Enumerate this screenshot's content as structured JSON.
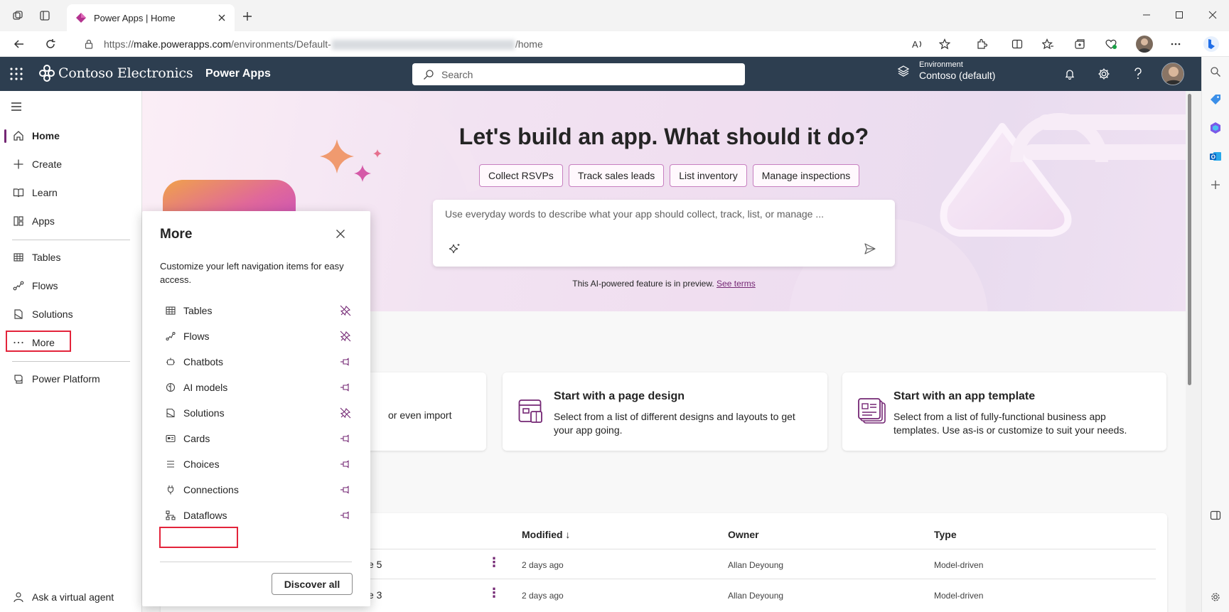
{
  "browser": {
    "tab_title": "Power Apps | Home",
    "url_prefix": "https://",
    "url_host": "make.powerapps.com",
    "url_path": "/environments/Default-",
    "url_tail": "/home"
  },
  "header": {
    "brand": "Contoso Electronics",
    "product": "Power Apps",
    "search_placeholder": "Search",
    "environment_label": "Environment",
    "environment_value": "Contoso (default)"
  },
  "nav": {
    "items": [
      {
        "label": "Home",
        "icon": "home-icon"
      },
      {
        "label": "Create",
        "icon": "plus-icon"
      },
      {
        "label": "Learn",
        "icon": "book-icon"
      },
      {
        "label": "Apps",
        "icon": "apps-icon"
      },
      {
        "label": "Tables",
        "icon": "table-icon"
      },
      {
        "label": "Flows",
        "icon": "flow-icon"
      },
      {
        "label": "Solutions",
        "icon": "solutions-icon"
      },
      {
        "label": "More",
        "icon": "more-icon"
      },
      {
        "label": "Power Platform",
        "icon": "power-platform-icon"
      }
    ],
    "virtual_agent": "Ask a virtual agent"
  },
  "hero": {
    "title": "Let's build an app. What should it do?",
    "chips": [
      "Collect RSVPs",
      "Track sales leads",
      "List inventory",
      "Manage inspections"
    ],
    "prompt_placeholder": "Use everyday words to describe what your app should collect, track, list, or manage ...",
    "preview_note": "This AI-powered feature is in preview.",
    "see_terms": "See terms"
  },
  "cards": [
    {
      "title": "",
      "desc": "or even import"
    },
    {
      "title": "Start with a page design",
      "desc": "Select from a list of different designs and layouts to get your app going."
    },
    {
      "title": "Start with an app template",
      "desc": "Select from a list of fully-functional business app templates. Use as-is or customize to suit your needs."
    }
  ],
  "table": {
    "headers": {
      "modified": "Modified ↓",
      "owner": "Owner",
      "type": "Type"
    },
    "rows": [
      {
        "name": "e 5",
        "modified": "2 days ago",
        "owner": "Allan Deyoung",
        "type": "Model-driven"
      },
      {
        "name": "e 3",
        "modified": "2 days ago",
        "owner": "Allan Deyoung",
        "type": "Model-driven"
      }
    ]
  },
  "more_panel": {
    "title": "More",
    "description": "Customize your left navigation items for easy access.",
    "items": [
      {
        "label": "Tables",
        "pinned": true
      },
      {
        "label": "Flows",
        "pinned": true
      },
      {
        "label": "Chatbots",
        "pinned": false
      },
      {
        "label": "AI models",
        "pinned": false
      },
      {
        "label": "Solutions",
        "pinned": true
      },
      {
        "label": "Cards",
        "pinned": false
      },
      {
        "label": "Choices",
        "pinned": false
      },
      {
        "label": "Connections",
        "pinned": false
      },
      {
        "label": "Dataflows",
        "pinned": false
      }
    ],
    "discover_all": "Discover all"
  },
  "colors": {
    "accent": "#742774",
    "header_bg": "#2d3e50",
    "highlight_box": "#e3243b"
  }
}
